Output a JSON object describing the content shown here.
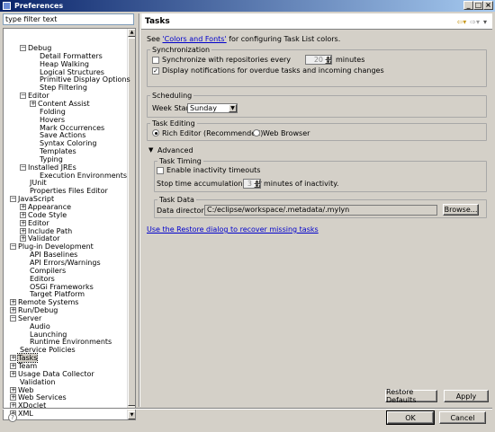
{
  "window": {
    "title": "Preferences"
  },
  "filter": {
    "placeholder": "type filter text",
    "value": "type filter text"
  },
  "tree": [
    {
      "label": "Debug",
      "level": 1,
      "exp": "-"
    },
    {
      "label": "Detail Formatters",
      "level": 2
    },
    {
      "label": "Heap Walking",
      "level": 2
    },
    {
      "label": "Logical Structures",
      "level": 2
    },
    {
      "label": "Primitive Display Options",
      "level": 2
    },
    {
      "label": "Step Filtering",
      "level": 2
    },
    {
      "label": "Editor",
      "level": 1,
      "exp": "-"
    },
    {
      "label": "Content Assist",
      "level": 2,
      "exp": "+"
    },
    {
      "label": "Folding",
      "level": 2
    },
    {
      "label": "Hovers",
      "level": 2
    },
    {
      "label": "Mark Occurrences",
      "level": 2
    },
    {
      "label": "Save Actions",
      "level": 2
    },
    {
      "label": "Syntax Coloring",
      "level": 2
    },
    {
      "label": "Templates",
      "level": 2
    },
    {
      "label": "Typing",
      "level": 2
    },
    {
      "label": "Installed JREs",
      "level": 1,
      "exp": "-"
    },
    {
      "label": "Execution Environments",
      "level": 2
    },
    {
      "label": "JUnit",
      "level": 1
    },
    {
      "label": "Properties Files Editor",
      "level": 1
    },
    {
      "label": "JavaScript",
      "level": 0,
      "exp": "-"
    },
    {
      "label": "Appearance",
      "level": 1,
      "exp": "+"
    },
    {
      "label": "Code Style",
      "level": 1,
      "exp": "+"
    },
    {
      "label": "Editor",
      "level": 1,
      "exp": "+"
    },
    {
      "label": "Include Path",
      "level": 1,
      "exp": "+"
    },
    {
      "label": "Validator",
      "level": 1,
      "exp": "+"
    },
    {
      "label": "Plug-in Development",
      "level": 0,
      "exp": "-"
    },
    {
      "label": "API Baselines",
      "level": 1
    },
    {
      "label": "API Errors/Warnings",
      "level": 1
    },
    {
      "label": "Compilers",
      "level": 1
    },
    {
      "label": "Editors",
      "level": 1
    },
    {
      "label": "OSGi Frameworks",
      "level": 1
    },
    {
      "label": "Target Platform",
      "level": 1
    },
    {
      "label": "Remote Systems",
      "level": 0,
      "exp": "+"
    },
    {
      "label": "Run/Debug",
      "level": 0,
      "exp": "+"
    },
    {
      "label": "Server",
      "level": 0,
      "exp": "-"
    },
    {
      "label": "Audio",
      "level": 1
    },
    {
      "label": "Launching",
      "level": 1
    },
    {
      "label": "Runtime Environments",
      "level": 1
    },
    {
      "label": "Service Policies",
      "level": 0
    },
    {
      "label": "Tasks",
      "level": 0,
      "exp": "+",
      "selected": true
    },
    {
      "label": "Team",
      "level": 0,
      "exp": "+"
    },
    {
      "label": "Usage Data Collector",
      "level": 0,
      "exp": "+"
    },
    {
      "label": "Validation",
      "level": 0
    },
    {
      "label": "Web",
      "level": 0,
      "exp": "+"
    },
    {
      "label": "Web Services",
      "level": 0,
      "exp": "+"
    },
    {
      "label": "XDoclet",
      "level": 0,
      "exp": "+"
    },
    {
      "label": "XML",
      "level": 0,
      "exp": "+"
    }
  ],
  "page": {
    "title": "Tasks",
    "intro_pre": "See ",
    "intro_link": "'Colors and Fonts'",
    "intro_post": " for configuring Task List colors.",
    "sync": {
      "title": "Synchronization",
      "sync_label": "Synchronize with repositories every",
      "sync_value": "20",
      "sync_unit": "minutes",
      "notify_label": "Display notifications for overdue tasks and incoming changes"
    },
    "scheduling": {
      "title": "Scheduling",
      "week_start_label": "Week Start:",
      "week_start_value": "Sunday"
    },
    "editing": {
      "title": "Task Editing",
      "rich_label": "Rich Editor (Recommended)",
      "web_label": "Web Browser"
    },
    "advanced": {
      "label": "Advanced",
      "timing_title": "Task Timing",
      "inactivity_label": "Enable inactivity timeouts",
      "stop_label": "Stop time accumulation after",
      "stop_value": "3",
      "stop_unit": "minutes of inactivity.",
      "data_title": "Task Data",
      "data_dir_label": "Data directory:",
      "data_dir_value": "C:/eclipse/workspace/.metadata/.mylyn",
      "browse_label": "Browse..."
    },
    "restore_link": "Use the Restore dialog to recover missing tasks",
    "restore_defaults": "Restore Defaults",
    "apply": "Apply"
  },
  "footer": {
    "ok": "OK",
    "cancel": "Cancel",
    "help_glyph": "?"
  }
}
